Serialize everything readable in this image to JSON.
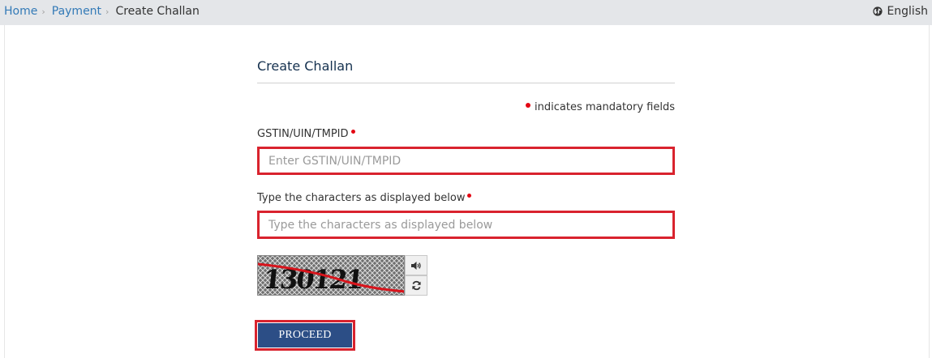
{
  "breadcrumb": {
    "home": "Home",
    "payment": "Payment",
    "current": "Create Challan",
    "separator": "›"
  },
  "language": {
    "label": "English",
    "icon": "globe-icon"
  },
  "form": {
    "title": "Create Challan",
    "mandatory_note": "indicates mandatory fields",
    "gstin": {
      "label": "GSTIN/UIN/TMPID",
      "placeholder": "Enter GSTIN/UIN/TMPID",
      "value": ""
    },
    "captcha_input": {
      "label": "Type the characters as displayed below",
      "placeholder": "Type the characters as displayed below",
      "value": ""
    },
    "captcha": {
      "text": "130121",
      "audio_icon": "speaker-icon",
      "refresh_icon": "refresh-icon"
    },
    "proceed_label": "PROCEED"
  },
  "colors": {
    "link": "#337ab7",
    "mandatory": "#e30613",
    "highlight_border": "#d9232e",
    "button_bg": "#2c4e86",
    "title": "#15314f"
  }
}
